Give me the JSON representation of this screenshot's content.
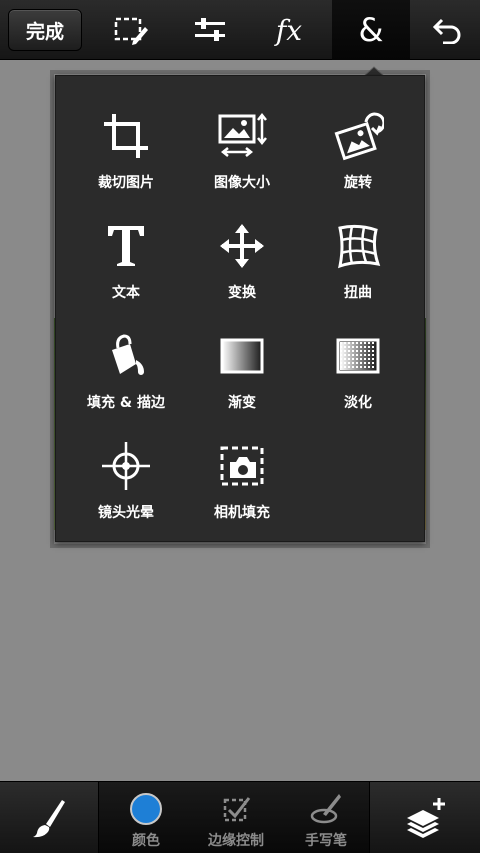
{
  "toolbar": {
    "done_label": "完成",
    "icons": [
      "selection-edit-icon",
      "adjustments-icon",
      "effects-icon",
      "extras-icon",
      "undo-icon"
    ],
    "fx_label": "fx",
    "amp_label": "&",
    "active_tab": "&"
  },
  "menu": {
    "items": [
      {
        "label": "裁切图片",
        "icon": "crop-icon"
      },
      {
        "label": "图像大小",
        "icon": "image-size-icon"
      },
      {
        "label": "旋转",
        "icon": "rotate-icon"
      },
      {
        "label": "文本",
        "icon": "text-icon"
      },
      {
        "label": "变换",
        "icon": "transform-icon"
      },
      {
        "label": "扭曲",
        "icon": "warp-icon"
      },
      {
        "label": "填充 & 描边",
        "icon": "fill-stroke-icon"
      },
      {
        "label": "渐变",
        "icon": "gradient-icon"
      },
      {
        "label": "淡化",
        "icon": "fade-icon"
      },
      {
        "label": "镜头光晕",
        "icon": "lens-flare-icon"
      },
      {
        "label": "相机填充",
        "icon": "camera-fill-icon"
      }
    ]
  },
  "bottom": {
    "tools": [
      {
        "label": "颜色",
        "icon": "color-swatch-icon"
      },
      {
        "label": "边缘控制",
        "icon": "edge-control-icon"
      },
      {
        "label": "手写笔",
        "icon": "stylus-icon"
      }
    ],
    "color_swatch": "#1e7fd6"
  }
}
